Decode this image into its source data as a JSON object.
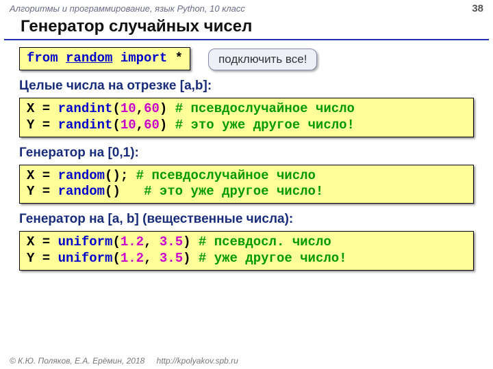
{
  "header": {
    "course": "Алгоритмы и программирование, язык Python, 10 класс",
    "page": "38"
  },
  "title": "Генератор случайных чисел",
  "import_line": {
    "from": "from",
    "module": "random",
    "import": "import",
    "star": "*"
  },
  "callout": "подключить все!",
  "sections": {
    "int_h": "Целые числа на отрезке [a,b]:",
    "int_code": {
      "l1": {
        "v": "X",
        "eq": " = ",
        "fn": "randint",
        "p1": "(",
        "a": "10",
        "c": ",",
        "b": "60",
        "p2": ")",
        "sp": " ",
        "cmt": "# псевдослучайное число"
      },
      "l2": {
        "v": "Y",
        "eq": " = ",
        "fn": "randint",
        "p1": "(",
        "a": "10",
        "c": ",",
        "b": "60",
        "p2": ")",
        "sp": " ",
        "cmt": "# это уже другое число!"
      }
    },
    "rand_h": "Генератор на [0,1):",
    "rand_code": {
      "l1": {
        "v": "X",
        "eq": " = ",
        "fn": "random",
        "p": "()",
        "sc": ";",
        "sp": " ",
        "cmt": "# псевдослучайное число"
      },
      "l2": {
        "v": "Y",
        "eq": " = ",
        "fn": "random",
        "p": "()",
        "sc": " ",
        "sp": "  ",
        "cmt": "# это уже другое число!"
      }
    },
    "unif_h": "Генератор на [a, b] (вещественные числа):",
    "unif_code": {
      "l1": {
        "v": "X",
        "eq": " = ",
        "fn": "uniform",
        "p1": "(",
        "a": "1.2",
        "c": ", ",
        "b": "3.5",
        "p2": ")",
        "sp": " ",
        "cmt": "# псевдосл. число"
      },
      "l2": {
        "v": "Y",
        "eq": " = ",
        "fn": "uniform",
        "p1": "(",
        "a": "1.2",
        "c": ", ",
        "b": "3.5",
        "p2": ")",
        "sp": " ",
        "cmt": "# уже другое число!"
      }
    }
  },
  "footer": {
    "copyright": "© К.Ю. Поляков, Е.А. Ерёмин, 2018",
    "url": "http://kpolyakov.spb.ru"
  }
}
